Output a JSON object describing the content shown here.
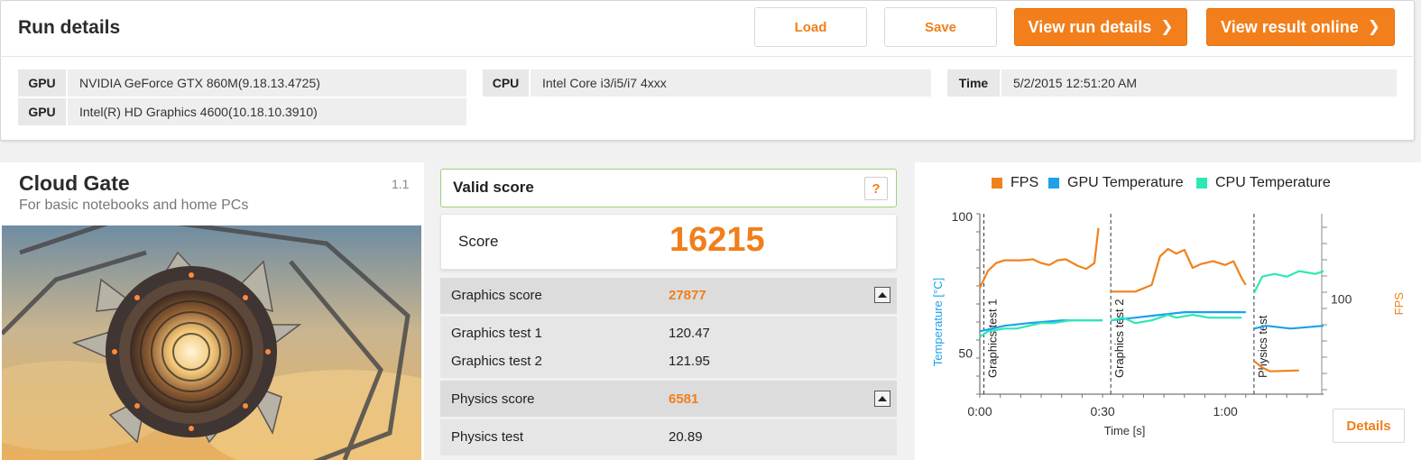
{
  "run": {
    "title": "Run details",
    "buttons": {
      "load": "Load",
      "save": "Save",
      "view_run_details": "View run details",
      "view_result_online": "View result online"
    },
    "gpu_rows": [
      {
        "key": "GPU",
        "value": "NVIDIA GeForce GTX 860M(9.18.13.4725)"
      },
      {
        "key": "GPU",
        "value": "Intel(R) HD Graphics 4600(10.18.10.3910)"
      }
    ],
    "cpu": {
      "key": "CPU",
      "value": "Intel Core i3/i5/i7 4xxx"
    },
    "time": {
      "key": "Time",
      "value": "5/2/2015 12:51:20 AM"
    }
  },
  "test": {
    "name": "Cloud Gate",
    "subtitle": "For basic notebooks and home PCs",
    "version": "1.1"
  },
  "score": {
    "valid_label": "Valid score",
    "help_icon_text": "?",
    "label": "Score",
    "value": "16215",
    "graphics": {
      "label": "Graphics score",
      "value": "27877",
      "tests": [
        {
          "label": "Graphics test 1",
          "value": "120.47"
        },
        {
          "label": "Graphics test 2",
          "value": "121.95"
        }
      ]
    },
    "physics": {
      "label": "Physics score",
      "value": "6581",
      "tests": [
        {
          "label": "Physics test",
          "value": "20.89"
        }
      ]
    }
  },
  "details_button": "Details",
  "colors": {
    "accent": "#f27f1b",
    "fps": "#f0821e",
    "gpu_temp": "#1ea0ec",
    "cpu_temp": "#2de8b4",
    "valid_border": "#9ed27a"
  },
  "chart_data": {
    "type": "line",
    "legend": [
      "FPS",
      "GPU Temperature",
      "CPU Temperature"
    ],
    "legend_position": "top",
    "xlabel": "Time [s]",
    "ylabel_left": "Temperature [°C]",
    "ylabel_right": "FPS",
    "x_ticks": [
      "0:00",
      "0:30",
      "1:00"
    ],
    "y_ticks_left": [
      "100",
      "50"
    ],
    "y_ticks_right": [
      "100"
    ],
    "x_unit": "seconds",
    "xlim": [
      0,
      84
    ],
    "ylim_left": [
      35,
      101
    ],
    "ylim_right": [
      0,
      190
    ],
    "markers": [
      {
        "x": 1,
        "label": "Graphics test 1"
      },
      {
        "x": 32,
        "label": "Graphics test 2"
      },
      {
        "x": 67,
        "label": "Physics test"
      }
    ],
    "series": [
      {
        "name": "FPS",
        "axis": "right",
        "segments": [
          [
            [
              0,
              112
            ],
            [
              2,
              130
            ],
            [
              4,
              138
            ],
            [
              6,
              141
            ],
            [
              10,
              141
            ],
            [
              13,
              142
            ],
            [
              15,
              138
            ],
            [
              17,
              136
            ],
            [
              19,
              141
            ],
            [
              21,
              142
            ],
            [
              24,
              135
            ],
            [
              26,
              132
            ],
            [
              28,
              138
            ],
            [
              29,
              175
            ]
          ],
          [
            [
              32,
              108
            ],
            [
              38,
              108
            ],
            [
              42,
              115
            ],
            [
              44,
              145
            ],
            [
              46,
              153
            ],
            [
              48,
              148
            ],
            [
              50,
              152
            ],
            [
              52,
              133
            ],
            [
              54,
              137
            ],
            [
              57,
              140
            ],
            [
              60,
              136
            ],
            [
              62,
              140
            ],
            [
              64,
              122
            ],
            [
              65,
              115
            ]
          ],
          [
            [
              67,
              35
            ],
            [
              69,
              28
            ],
            [
              71,
              24
            ],
            [
              78,
              25
            ]
          ]
        ]
      },
      {
        "name": "GPU Temperature",
        "axis": "left",
        "segments": [
          [
            [
              0,
              58
            ],
            [
              3,
              59
            ],
            [
              6,
              60
            ],
            [
              12,
              61
            ],
            [
              20,
              62
            ],
            [
              30,
              62
            ]
          ],
          [
            [
              32,
              62
            ],
            [
              38,
              63
            ],
            [
              44,
              64
            ],
            [
              50,
              65
            ],
            [
              65,
              65
            ]
          ],
          [
            [
              67,
              59
            ],
            [
              70,
              60
            ],
            [
              76,
              59
            ],
            [
              84,
              60
            ]
          ]
        ]
      },
      {
        "name": "CPU Temperature",
        "axis": "left",
        "segments": [
          [
            [
              0,
              56
            ],
            [
              2,
              58
            ],
            [
              6,
              59
            ],
            [
              9,
              59
            ],
            [
              12,
              60
            ],
            [
              15,
              61
            ],
            [
              18,
              61
            ],
            [
              22,
              62
            ],
            [
              26,
              62
            ],
            [
              30,
              62
            ]
          ],
          [
            [
              32,
              62
            ],
            [
              35,
              63
            ],
            [
              38,
              61
            ],
            [
              42,
              62
            ],
            [
              46,
              64
            ],
            [
              48,
              63
            ],
            [
              52,
              64
            ],
            [
              56,
              63
            ],
            [
              64,
              63
            ]
          ],
          [
            [
              67,
              72
            ],
            [
              69,
              78
            ],
            [
              72,
              79
            ],
            [
              75,
              78
            ],
            [
              78,
              80
            ],
            [
              82,
              79
            ],
            [
              84,
              80
            ]
          ]
        ]
      }
    ]
  }
}
